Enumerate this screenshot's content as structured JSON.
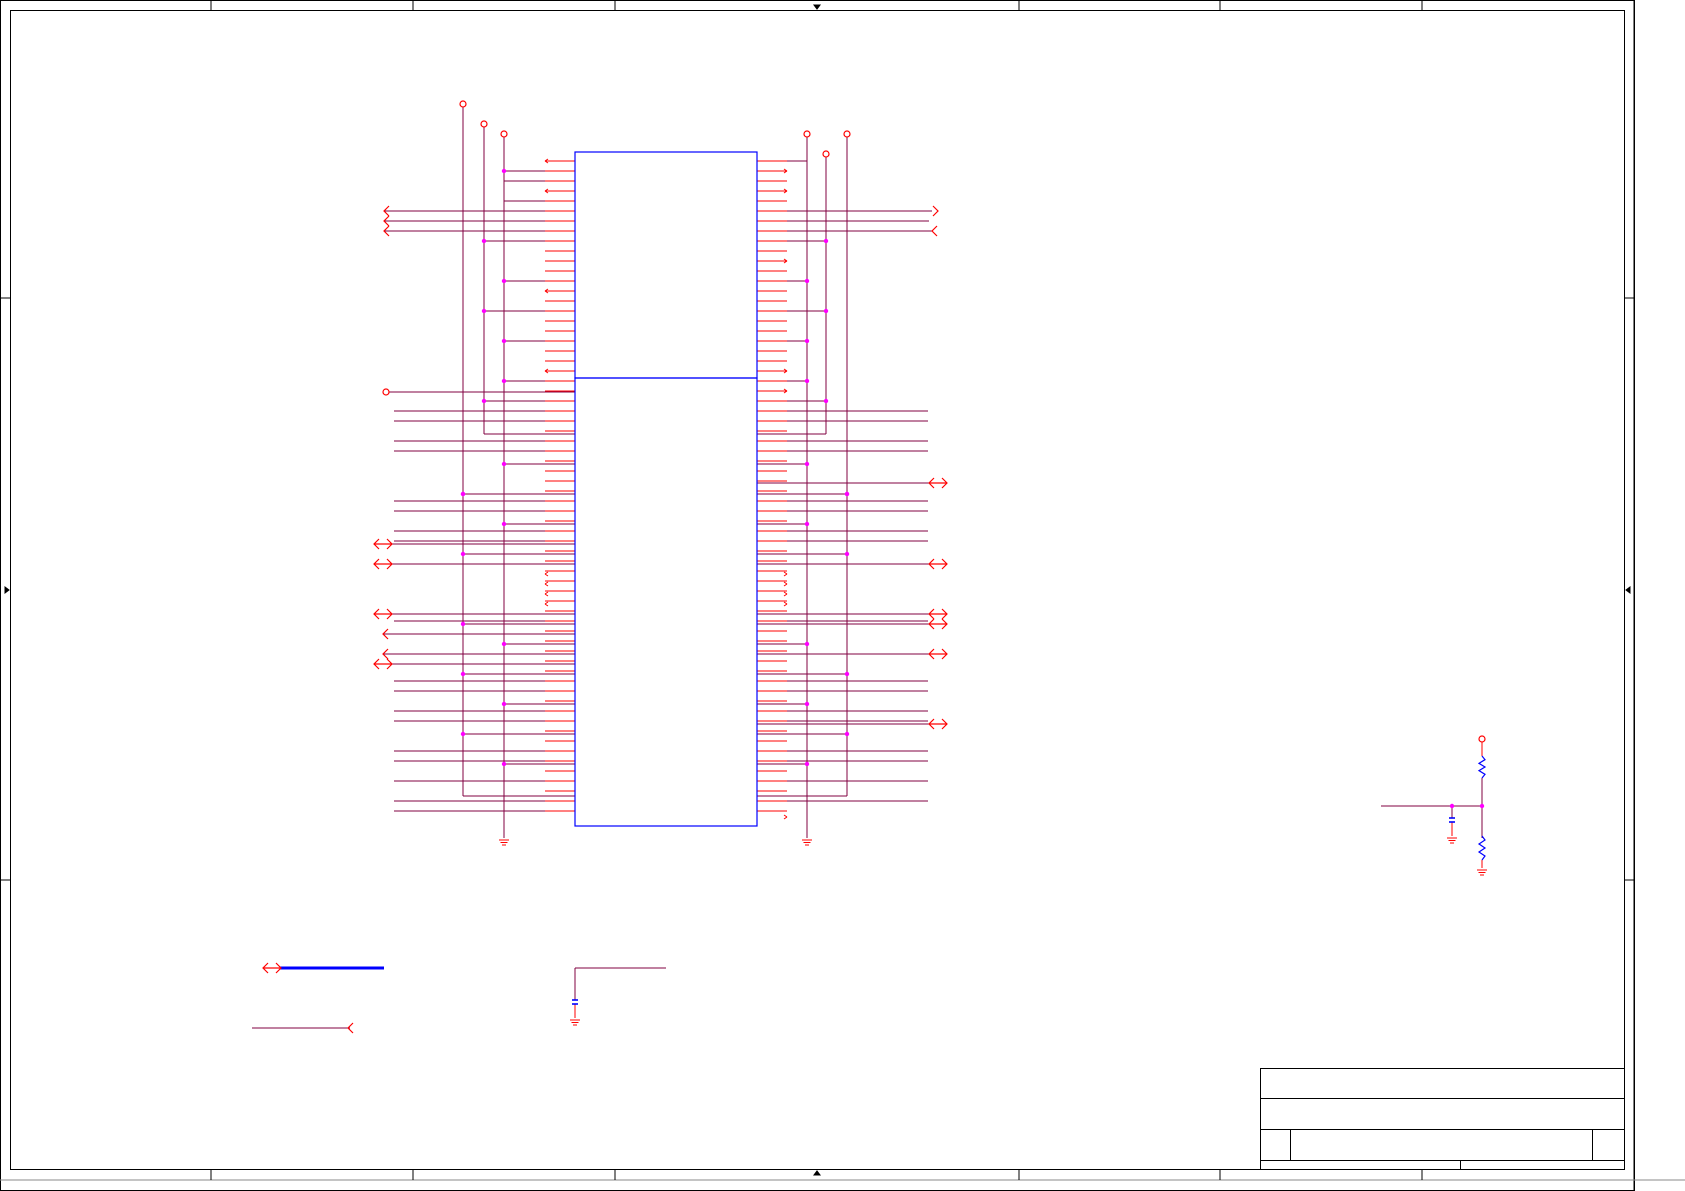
{
  "sheet": {
    "title_block": {
      "title": "",
      "size": "",
      "document_number": "",
      "revision": "",
      "date": "",
      "sheet_number": ""
    }
  },
  "colors": {
    "border": "#000000",
    "wire": "#800040",
    "pin": "#ff0000",
    "symbol_body": "#0000ff",
    "junction": "#ff00ff",
    "port": "#ff0000",
    "bus": "#0000ff"
  },
  "components": {
    "connector": {
      "part_count": 2,
      "pins_per_side_upper": 23,
      "pins_per_side_lower": 44
    },
    "pullup_resistor": {
      "kind": "resistor"
    },
    "pulldown_resistor": {
      "kind": "resistor"
    },
    "filter_capacitor": {
      "kind": "capacitor"
    },
    "decoupling_capacitor": {
      "kind": "capacitor"
    }
  },
  "icons": {
    "power_port": "open-circle-power-icon",
    "ground": "ground-symbol-icon",
    "bidirectional_port": "bidirectional-port-icon",
    "input_port": "input-port-icon",
    "no_connect": "no-connect-icon",
    "junction": "junction-dot-icon"
  }
}
